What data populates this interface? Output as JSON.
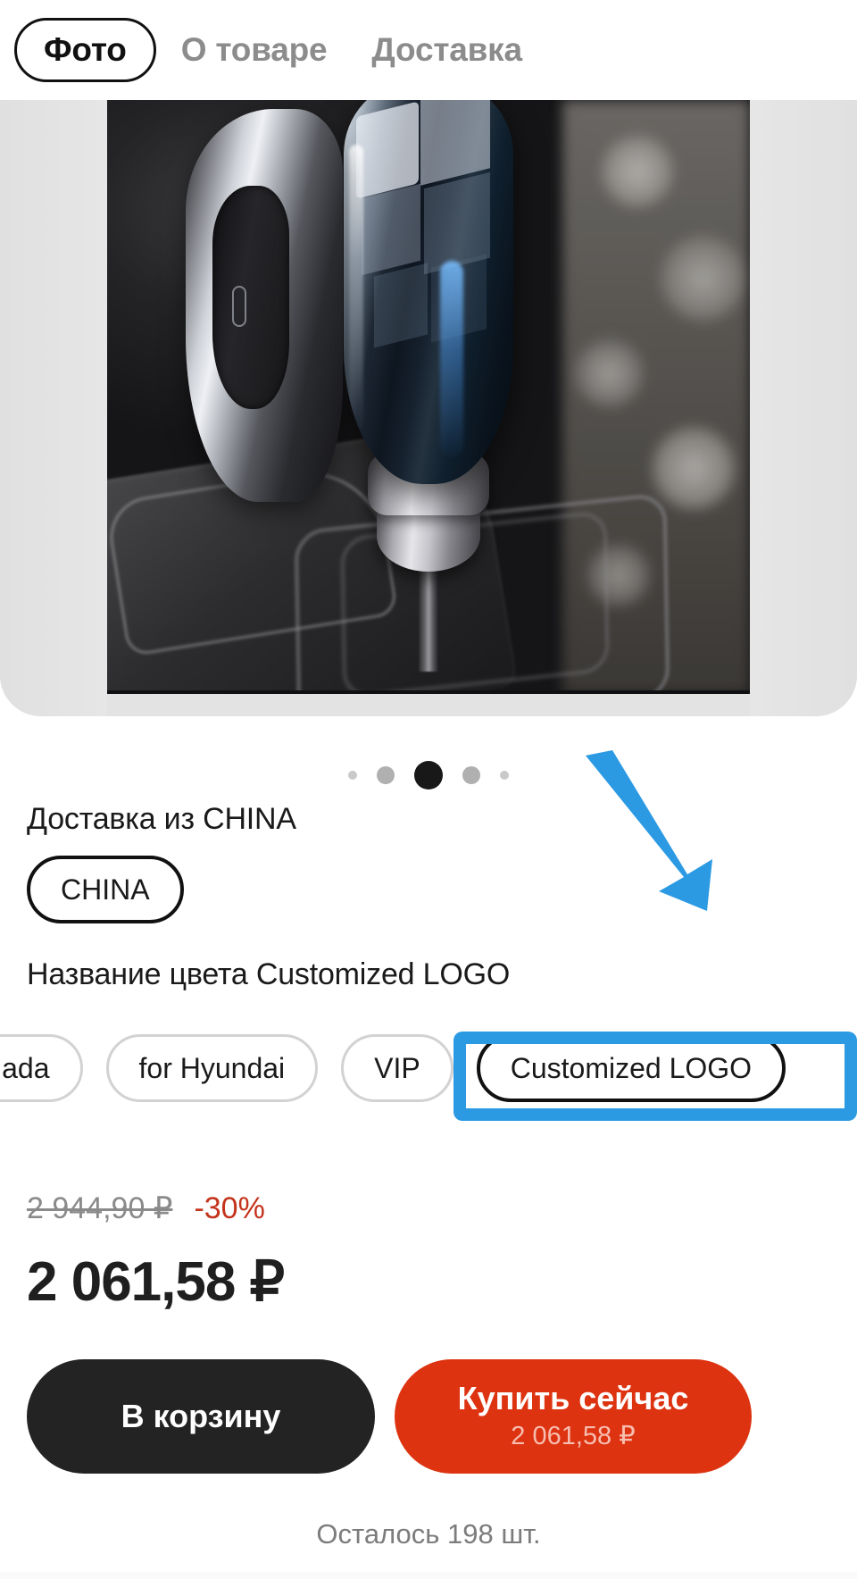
{
  "tabs": [
    {
      "label": "Фото",
      "active": true
    },
    {
      "label": "О товаре",
      "active": false
    },
    {
      "label": "Доставка",
      "active": false
    }
  ],
  "gallery": {
    "image_description": "Хрустальная ручка КПП с хромированной отделкой",
    "dots": [
      {
        "size": "small"
      },
      {
        "size": "medium"
      },
      {
        "size": "active"
      },
      {
        "size": "medium"
      },
      {
        "size": "small"
      }
    ],
    "active_index": 2
  },
  "delivery": {
    "title": "Доставка из CHINA",
    "chips": [
      {
        "label": "CHINA",
        "selected": true
      }
    ]
  },
  "color": {
    "title": "Название цвета Customized LOGO",
    "chips": [
      {
        "label": "lada",
        "selected": false
      },
      {
        "label": "for Hyundai",
        "selected": false
      },
      {
        "label": "VIP",
        "selected": false
      },
      {
        "label": "Customized LOGO",
        "selected": true
      }
    ]
  },
  "annotations": {
    "arrow_color": "#2b9ae3",
    "box_color": "#2b9ae3",
    "target": "Customized LOGO"
  },
  "price": {
    "old": "2 944,90 ₽",
    "discount": "-30%",
    "current": "2 061,58 ₽",
    "discount_color": "#c4331b"
  },
  "actions": {
    "cart_label": "В корзину",
    "buy_label": "Купить сейчас",
    "buy_price": "2 061,58 ₽",
    "cart_color": "#232323",
    "buy_color": "#dd3310"
  },
  "stock": {
    "note": "Осталось 198 шт."
  }
}
